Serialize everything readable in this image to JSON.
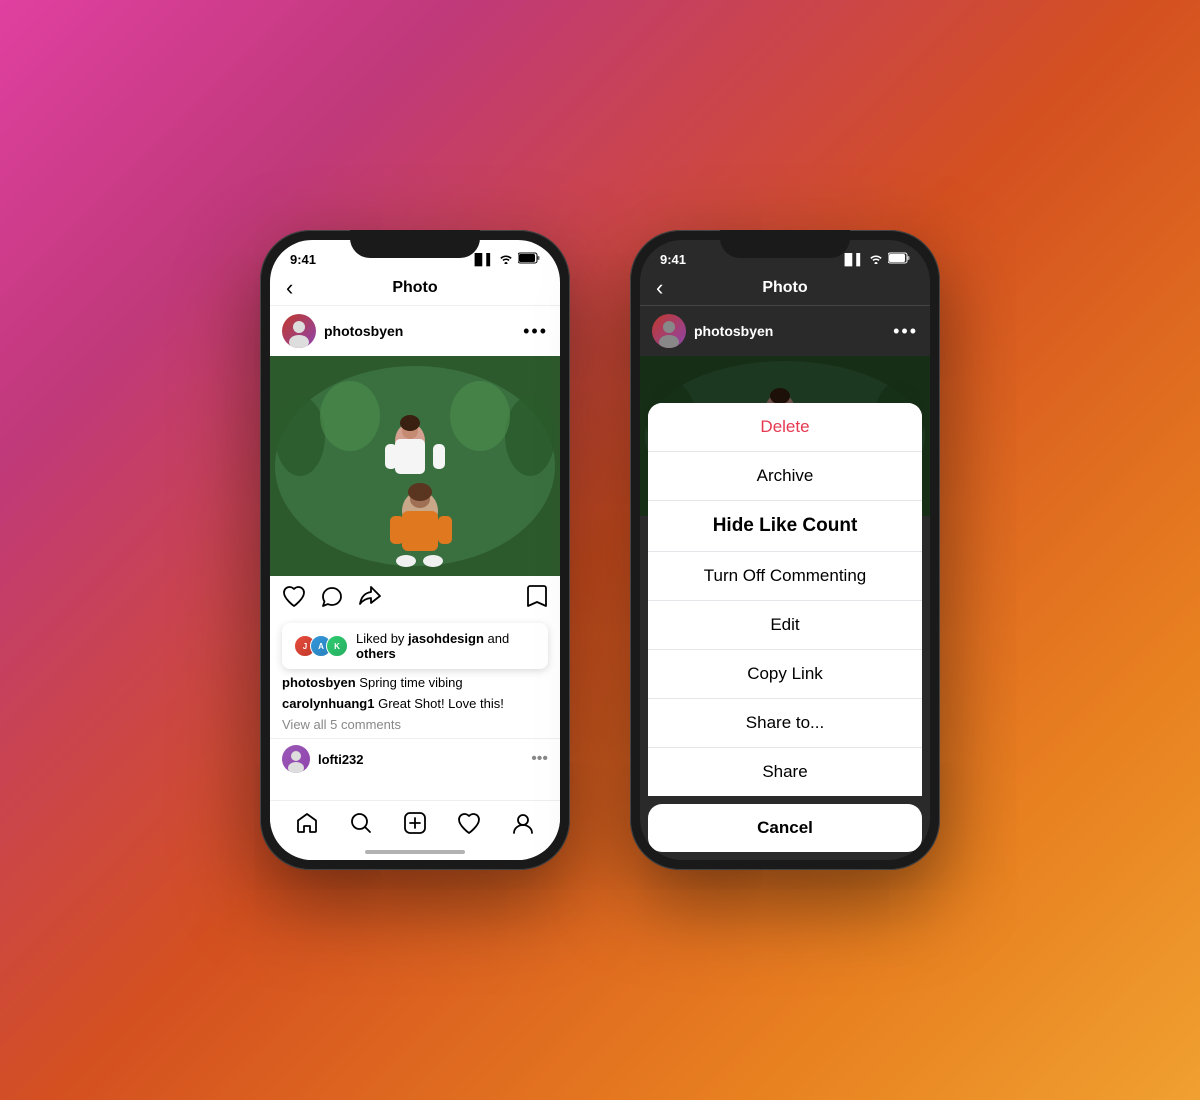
{
  "left_phone": {
    "status_time": "9:41",
    "status_signal": "▐▌▌",
    "status_wifi": "wifi",
    "status_battery": "🔋",
    "nav_title": "Photo",
    "back_label": "‹",
    "username": "photosbyen",
    "dots_label": "•••",
    "action_like": "♡",
    "action_comment": "○",
    "action_share": "✈",
    "action_bookmark": "⊡",
    "likes_text_1": "Liked by ",
    "likes_bold1": "jasohdesign",
    "likes_text_2": " and ",
    "likes_bold2": "others",
    "caption_user": "photosbyen",
    "caption_text": "Spring time vibing",
    "comment_user": "carolynhuang1",
    "comment_text": "Great Shot! Love this!",
    "view_comments": "View all 5 comments",
    "commenter": "lofti232",
    "bottom_nav": [
      "🏠",
      "🔍",
      "⊕",
      "♡",
      "👤"
    ]
  },
  "right_phone": {
    "status_time": "9:41",
    "nav_title": "Photo",
    "back_label": "‹",
    "username": "photosbyen",
    "dots_label": "•••",
    "sheet_items": [
      {
        "label": "Delete",
        "style": "red"
      },
      {
        "label": "Archive",
        "style": "normal"
      },
      {
        "label": "Hide Like Count",
        "style": "bold"
      },
      {
        "label": "Turn Off Commenting",
        "style": "normal"
      },
      {
        "label": "Edit",
        "style": "normal"
      },
      {
        "label": "Copy Link",
        "style": "normal"
      },
      {
        "label": "Share to...",
        "style": "normal"
      },
      {
        "label": "Share",
        "style": "normal"
      }
    ],
    "cancel_label": "Cancel"
  },
  "colors": {
    "delete_red": "#e63950",
    "sheet_bg": "#f2f2f7",
    "accent": "#e1306c"
  }
}
